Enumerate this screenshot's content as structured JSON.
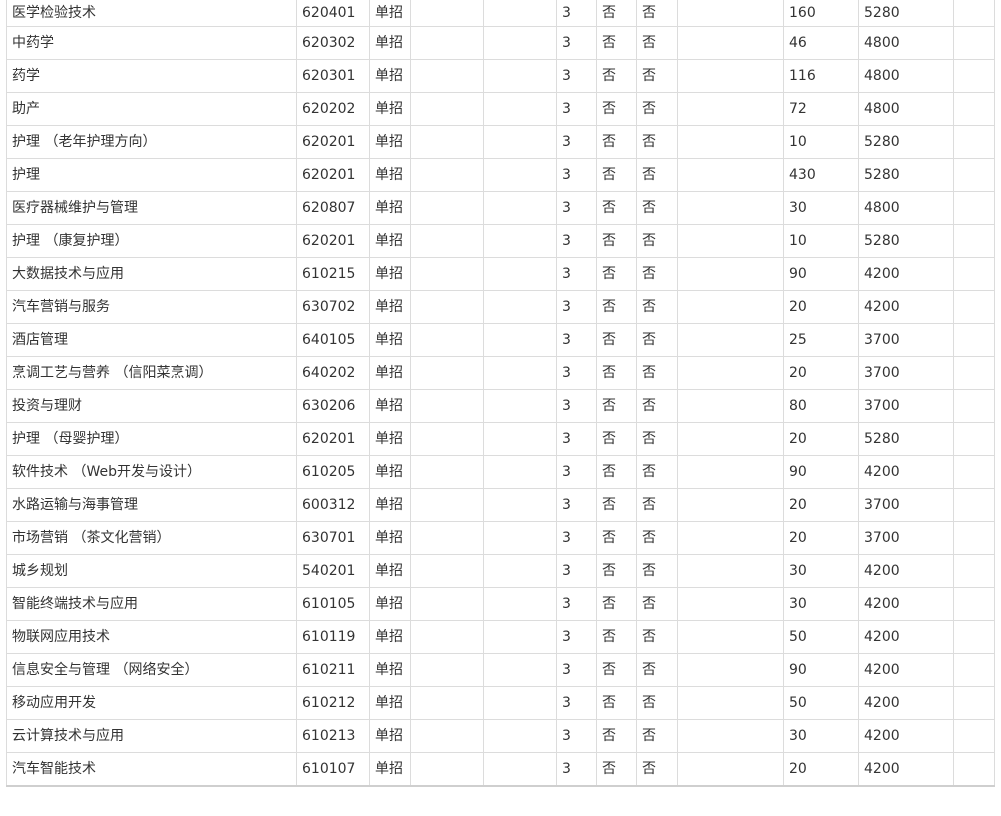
{
  "table": {
    "rows": [
      [
        "医学检验技术",
        "620401",
        "单招",
        "",
        "",
        "3",
        "否",
        "否",
        "",
        "160",
        "5280",
        ""
      ],
      [
        "中药学",
        "620302",
        "单招",
        "",
        "",
        "3",
        "否",
        "否",
        "",
        "46",
        "4800",
        ""
      ],
      [
        "药学",
        "620301",
        "单招",
        "",
        "",
        "3",
        "否",
        "否",
        "",
        "116",
        "4800",
        ""
      ],
      [
        "助产",
        "620202",
        "单招",
        "",
        "",
        "3",
        "否",
        "否",
        "",
        "72",
        "4800",
        ""
      ],
      [
        "护理 （老年护理方向）",
        "620201",
        "单招",
        "",
        "",
        "3",
        "否",
        "否",
        "",
        "10",
        "5280",
        ""
      ],
      [
        "护理",
        "620201",
        "单招",
        "",
        "",
        "3",
        "否",
        "否",
        "",
        "430",
        "5280",
        ""
      ],
      [
        "医疗器械维护与管理",
        "620807",
        "单招",
        "",
        "",
        "3",
        "否",
        "否",
        "",
        "30",
        "4800",
        ""
      ],
      [
        "护理 （康复护理）",
        "620201",
        "单招",
        "",
        "",
        "3",
        "否",
        "否",
        "",
        "10",
        "5280",
        ""
      ],
      [
        "大数据技术与应用",
        "610215",
        "单招",
        "",
        "",
        "3",
        "否",
        "否",
        "",
        "90",
        "4200",
        ""
      ],
      [
        "汽车营销与服务",
        "630702",
        "单招",
        "",
        "",
        "3",
        "否",
        "否",
        "",
        "20",
        "4200",
        ""
      ],
      [
        "酒店管理",
        "640105",
        "单招",
        "",
        "",
        "3",
        "否",
        "否",
        "",
        "25",
        "3700",
        ""
      ],
      [
        "烹调工艺与营养 （信阳菜烹调）",
        "640202",
        "单招",
        "",
        "",
        "3",
        "否",
        "否",
        "",
        "20",
        "3700",
        ""
      ],
      [
        "投资与理财",
        "630206",
        "单招",
        "",
        "",
        "3",
        "否",
        "否",
        "",
        "80",
        "3700",
        ""
      ],
      [
        "护理 （母婴护理）",
        "620201",
        "单招",
        "",
        "",
        "3",
        "否",
        "否",
        "",
        "20",
        "5280",
        ""
      ],
      [
        "软件技术 （Web开发与设计）",
        "610205",
        "单招",
        "",
        "",
        "3",
        "否",
        "否",
        "",
        "90",
        "4200",
        ""
      ],
      [
        "水路运输与海事管理",
        "600312",
        "单招",
        "",
        "",
        "3",
        "否",
        "否",
        "",
        "20",
        "3700",
        ""
      ],
      [
        "市场营销 （茶文化营销）",
        "630701",
        "单招",
        "",
        "",
        "3",
        "否",
        "否",
        "",
        "20",
        "3700",
        ""
      ],
      [
        "城乡规划",
        "540201",
        "单招",
        "",
        "",
        "3",
        "否",
        "否",
        "",
        "30",
        "4200",
        ""
      ],
      [
        "智能终端技术与应用",
        "610105",
        "单招",
        "",
        "",
        "3",
        "否",
        "否",
        "",
        "30",
        "4200",
        ""
      ],
      [
        "物联网应用技术",
        "610119",
        "单招",
        "",
        "",
        "3",
        "否",
        "否",
        "",
        "50",
        "4200",
        ""
      ],
      [
        "信息安全与管理 （网络安全）",
        "610211",
        "单招",
        "",
        "",
        "3",
        "否",
        "否",
        "",
        "90",
        "4200",
        ""
      ],
      [
        "移动应用开发",
        "610212",
        "单招",
        "",
        "",
        "3",
        "否",
        "否",
        "",
        "50",
        "4200",
        ""
      ],
      [
        "云计算技术与应用",
        "610213",
        "单招",
        "",
        "",
        "3",
        "否",
        "否",
        "",
        "30",
        "4200",
        ""
      ],
      [
        "汽车智能技术",
        "610107",
        "单招",
        "",
        "",
        "3",
        "否",
        "否",
        "",
        "20",
        "4200",
        ""
      ]
    ]
  },
  "colors": {
    "text": "#333333",
    "border": "#dcdcdc",
    "background": "#ffffff"
  }
}
